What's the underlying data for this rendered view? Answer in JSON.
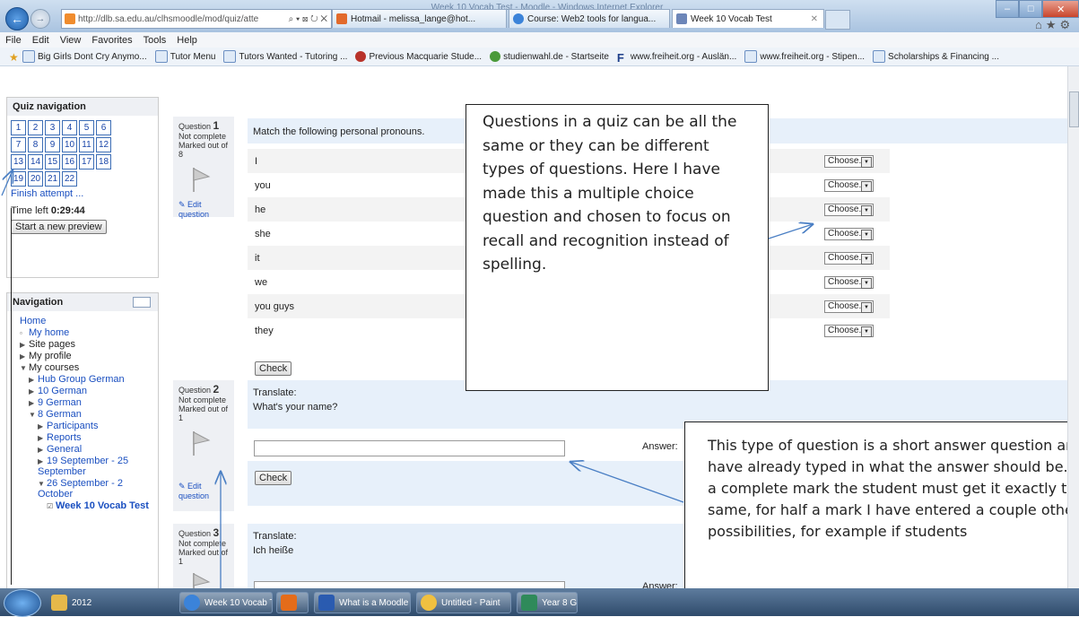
{
  "window": {
    "title": "Week 10 Vocab Test - Moodle - Windows Internet Explorer"
  },
  "browser": {
    "address": "http://dlb.sa.edu.au/clhsmoodle/mod/quiz/atte",
    "address_controls": "⌕ ▾ ⊠ ↻ ✕",
    "tabs": [
      {
        "label": "Hotmail - melissa_lange@hot...",
        "color": "#e26a2c"
      },
      {
        "label": "Course: Web2 tools for langua...",
        "color": "#3b83d9"
      },
      {
        "label": "Week 10 Vocab Test",
        "color": "#6d86b8"
      }
    ],
    "menu": [
      "File",
      "Edit",
      "View",
      "Favorites",
      "Tools",
      "Help"
    ],
    "favorites": [
      {
        "label": "Big Girls Dont Cry Anymo...",
        "icon": "page-icon"
      },
      {
        "label": "Tutor Menu",
        "icon": "page-icon"
      },
      {
        "label": "Tutors Wanted - Tutoring ...",
        "icon": "page-icon"
      },
      {
        "label": "Previous Macquarie Stude...",
        "icon": "leaf-icon"
      },
      {
        "label": "studienwahl.de - Startseite",
        "icon": "star-icon"
      },
      {
        "label": "www.freiheit.org - Auslän...",
        "icon": "f-icon"
      },
      {
        "label": "www.freiheit.org - Stipen...",
        "icon": "page-icon"
      },
      {
        "label": "Scholarships & Financing ...",
        "icon": "page-icon"
      }
    ]
  },
  "quiz_nav": {
    "title": "Quiz navigation",
    "rows": [
      [
        "1",
        "2",
        "3",
        "4",
        "5",
        "6"
      ],
      [
        "7",
        "8",
        "9",
        "10",
        "11",
        "12"
      ],
      [
        "13",
        "14",
        "15",
        "16",
        "17",
        "18"
      ],
      [
        "19",
        "20",
        "21",
        "22"
      ]
    ],
    "finish": "Finish attempt ...",
    "time_label": "Time left",
    "time_value": "0:29:44",
    "preview_button": "Start a new preview"
  },
  "navigation": {
    "title": "Navigation",
    "items": [
      {
        "label": "Home",
        "indent": 0,
        "marker": ""
      },
      {
        "label": "My home",
        "indent": 1,
        "marker": "▫"
      },
      {
        "label": "Site pages",
        "indent": 1,
        "marker": "▶"
      },
      {
        "label": "My profile",
        "indent": 1,
        "marker": "▶"
      },
      {
        "label": "My courses",
        "indent": 1,
        "marker": "▼"
      },
      {
        "label": "Hub Group German",
        "indent": 2,
        "marker": "▶"
      },
      {
        "label": "10 German",
        "indent": 2,
        "marker": "▶"
      },
      {
        "label": "9 German",
        "indent": 2,
        "marker": "▶"
      },
      {
        "label": "8 German",
        "indent": 2,
        "marker": "▼"
      },
      {
        "label": "Participants",
        "indent": 3,
        "marker": "▶"
      },
      {
        "label": "Reports",
        "indent": 3,
        "marker": "▶"
      },
      {
        "label": "General",
        "indent": 3,
        "marker": "▶"
      },
      {
        "label": "19 September - 25 September",
        "indent": 3,
        "marker": "▶"
      },
      {
        "label": "26 September - 2 October",
        "indent": 3,
        "marker": "▼"
      },
      {
        "label": "Week 10 Vocab Test",
        "indent": 4,
        "marker": "☑"
      }
    ]
  },
  "q1": {
    "label": "Question",
    "number": "1",
    "status": "Not complete",
    "marks": "Marked out of 8",
    "edit": "Edit question",
    "text": "Match the following personal pronouns.",
    "rows": [
      "I",
      "you",
      "he",
      "she",
      "it",
      "we",
      "you guys",
      "they"
    ],
    "choose": "Choose...",
    "check": "Check"
  },
  "q2": {
    "label": "Question",
    "number": "2",
    "status": "Not complete",
    "marks": "Marked out of 1",
    "edit": "Edit question",
    "line1": "Translate:",
    "line2": "What's your name?",
    "answer_label": "Answer:",
    "check": "Check"
  },
  "q3": {
    "label": "Question",
    "number": "3",
    "status": "Not complete",
    "marks": "Marked out of 1",
    "line1": "Translate:",
    "line2": "Ich heiße",
    "answer_label": "Answer:"
  },
  "callout1": "Questions in a quiz can be all the same or they can be different types of questions. Here I have made this a multiple choice question and chosen to focus on recall and recognition instead of spelling.",
  "callout2": "This type of question is a short answer question and I have already typed in what the answer should be. For a complete mark the student must get it exactly the same, for half a mark I have entered a couple other possibilities, for example if students",
  "taskbar": {
    "items": [
      {
        "label": "2012",
        "color": "#e6b84a"
      },
      {
        "label": "Week 10 Vocab T...",
        "color": "#3b83d9"
      },
      {
        "label": "",
        "color": "#e46c1a"
      },
      {
        "label": "What is a Moodle ...",
        "color": "#2a5bb0"
      },
      {
        "label": "Untitled - Paint",
        "color": "#f0c040"
      },
      {
        "label": "Year 8 G",
        "color": "#2f8a5a"
      }
    ]
  },
  "colors": {
    "link": "#1a4fc0",
    "question_bg": "#e7f0fa",
    "title_bar": "#a9c3e0"
  }
}
